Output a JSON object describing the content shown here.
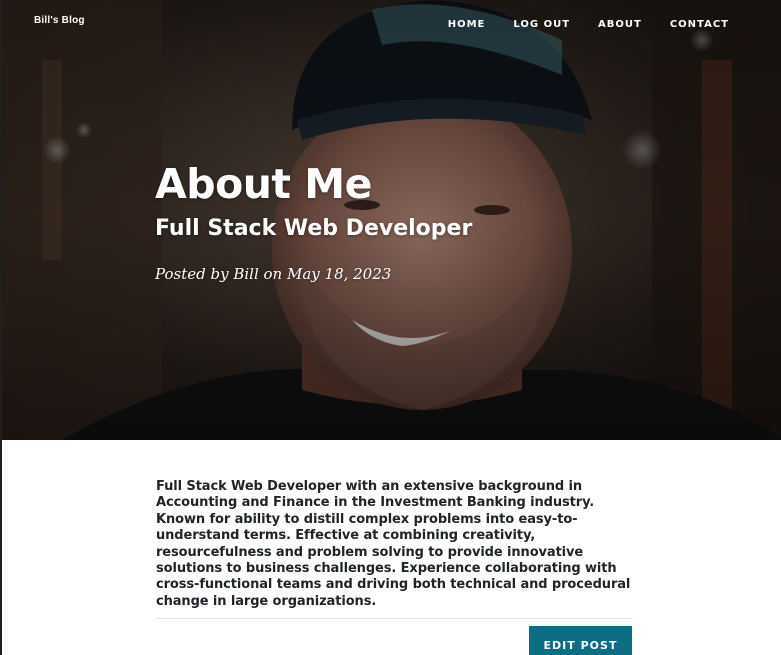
{
  "navbar": {
    "brand": "Bill's Blog",
    "links": [
      "HOME",
      "LOG OUT",
      "ABOUT",
      "CONTACT"
    ]
  },
  "hero": {
    "title": "About Me",
    "subtitle": "Full Stack Web Developer",
    "meta": "Posted by Bill on May 18, 2023"
  },
  "content": {
    "body": "Full Stack Web Developer with an extensive background in Accounting and Finance in the Investment Banking industry. Known for ability to distill complex problems into easy-to-understand terms. Effective at combining creativity, resourcefulness and problem solving to provide innovative solutions to business challenges. Experience collaborating with cross-functional teams and driving both technical and procedural change in large organizations.",
    "edit_button": "EDIT POST"
  },
  "colors": {
    "accent": "#0d6d82",
    "hero_overlay": "#2a221d",
    "text": "#212529"
  }
}
